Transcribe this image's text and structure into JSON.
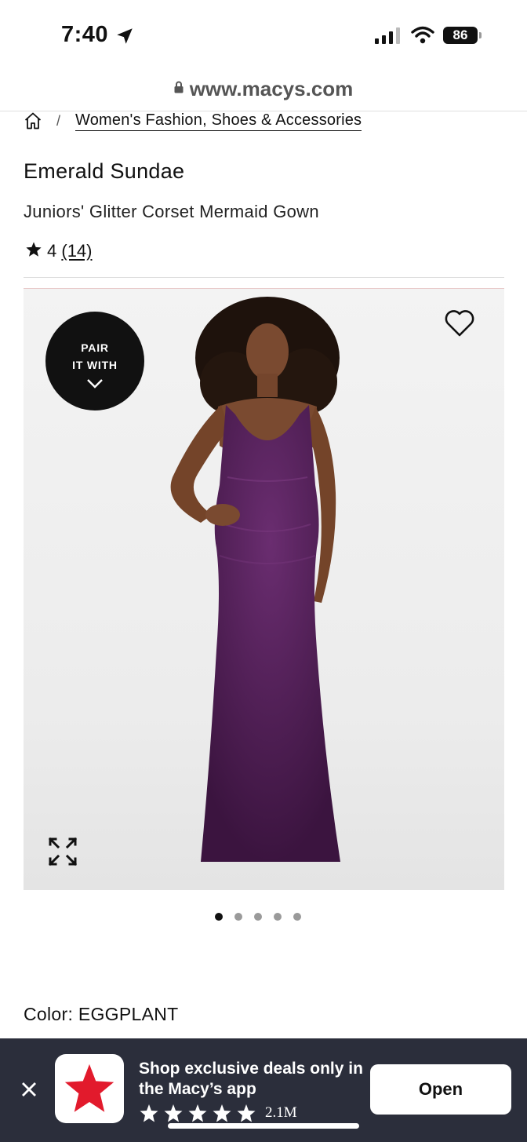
{
  "status_bar": {
    "time": "7:40",
    "battery": "86",
    "icons": [
      "location-arrow-icon",
      "signal-icon",
      "wifi-icon",
      "battery-icon"
    ]
  },
  "browser": {
    "url": "www.macys.com",
    "icon": "lock-icon"
  },
  "breadcrumb": {
    "home_icon": "home-icon",
    "separator": "/",
    "link": "Women's Fashion, Shoes & Accessories"
  },
  "product": {
    "brand": "Emerald Sundae",
    "name": "Juniors' Glitter Corset Mermaid Gown",
    "rating_value": "4",
    "review_count": "(14)",
    "image": {
      "pair_with_line1": "PAIR",
      "pair_with_line2": "IT WITH",
      "dress_color": "#4a1d4f",
      "total_images": 5,
      "active_image": 1
    },
    "color_label": "Color: EGGPLANT"
  },
  "app_banner": {
    "title": "Shop exclusive deals only in the Macy’s app",
    "stars": 5,
    "ratings_count": "2.1M",
    "open_label": "Open",
    "brand_color": "#e21a2c",
    "background": "#2b2e3b"
  }
}
